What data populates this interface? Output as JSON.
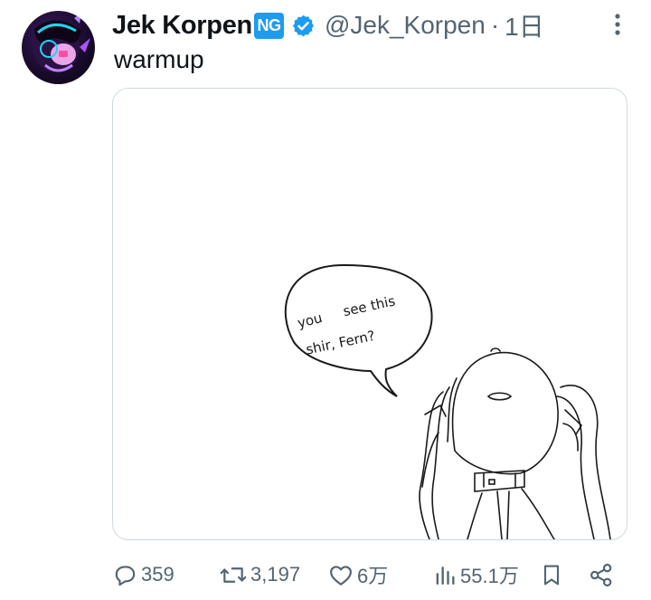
{
  "tweet": {
    "author_name": "Jek Korpen",
    "badge_label": "NG",
    "handle": "@Jek_Korpen",
    "separator": "·",
    "time": "1日",
    "text": "warmup"
  },
  "media": {
    "bubble_text_line1_a": "you",
    "bubble_text_line1_b": "see this",
    "bubble_text_line2": "shir, Fern?"
  },
  "actions": {
    "replies": "359",
    "reposts": "3,197",
    "likes": "6万",
    "views": "55.1万"
  },
  "icons": {
    "verified": "verified-badge-icon",
    "more": "more-icon",
    "reply": "reply-icon",
    "repost": "repost-icon",
    "like": "like-icon",
    "views": "views-icon",
    "bookmark": "bookmark-icon",
    "share": "share-icon"
  },
  "colors": {
    "accent": "#1d9bf0",
    "secondary_text": "#536471",
    "border": "#cfd9de"
  }
}
